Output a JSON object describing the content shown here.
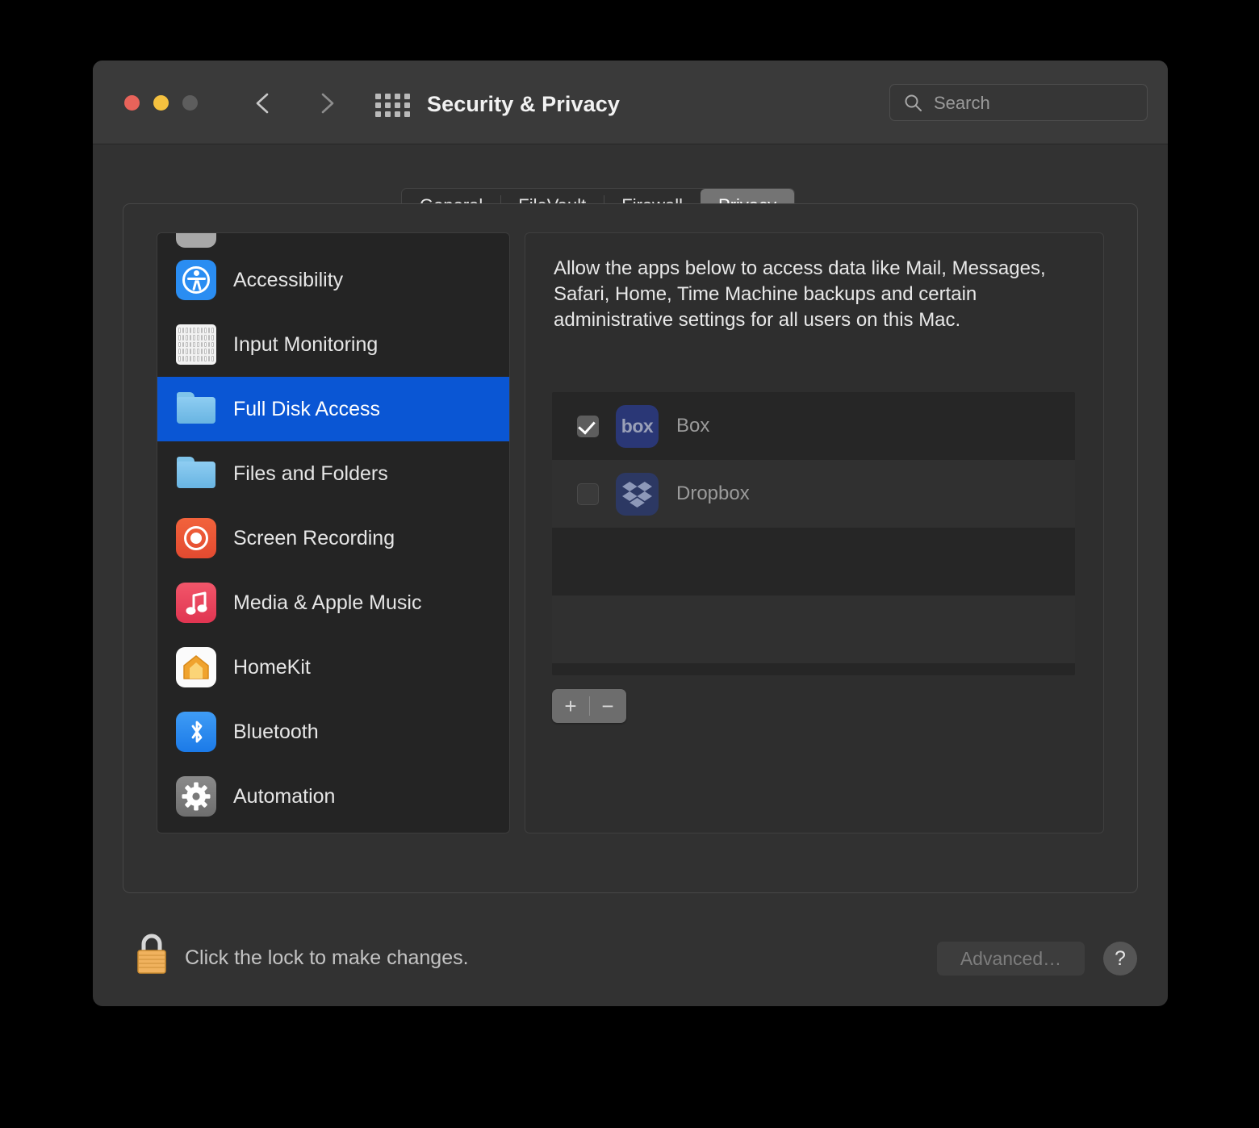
{
  "window": {
    "title": "Security & Privacy",
    "traffic_lights": {
      "close": "close-button",
      "minimize": "minimize-button",
      "zoom": "zoom-button"
    },
    "nav": {
      "back": "back-chevron-icon",
      "forward": "forward-chevron-icon",
      "grid": "show-all-grid-icon"
    },
    "colors": {
      "window_bg": "#323232",
      "titlebar_bg": "#3a3a3a",
      "accent_selection": "#0a56d4",
      "close": "#e8635a",
      "minimize": "#f5c13f",
      "zoom": "#5d5d5d"
    }
  },
  "search": {
    "placeholder": "Search",
    "value": "",
    "icon": "search-icon"
  },
  "tabs": [
    {
      "label": "General",
      "selected": false
    },
    {
      "label": "FileVault",
      "selected": false
    },
    {
      "label": "Firewall",
      "selected": false
    },
    {
      "label": "Privacy",
      "selected": true
    }
  ],
  "sidebar": {
    "items": [
      {
        "label": "Accessibility",
        "icon": "accessibility-icon",
        "selected": false
      },
      {
        "label": "Input Monitoring",
        "icon": "keyboard-icon",
        "selected": false
      },
      {
        "label": "Full Disk Access",
        "icon": "folder-icon",
        "selected": true
      },
      {
        "label": "Files and Folders",
        "icon": "folder-icon",
        "selected": false
      },
      {
        "label": "Screen Recording",
        "icon": "screen-recording-icon",
        "selected": false
      },
      {
        "label": "Media & Apple Music",
        "icon": "music-note-icon",
        "selected": false
      },
      {
        "label": "HomeKit",
        "icon": "home-icon",
        "selected": false
      },
      {
        "label": "Bluetooth",
        "icon": "bluetooth-icon",
        "selected": false
      },
      {
        "label": "Automation",
        "icon": "gear-icon",
        "selected": false
      }
    ]
  },
  "right_panel": {
    "description": "Allow the apps below to access data like Mail, Messages, Safari, Home, Time Machine backups and certain administrative settings for all users on this Mac.",
    "apps": [
      {
        "name": "Box",
        "checked": true,
        "icon": "box-app-icon",
        "icon_text": "box"
      },
      {
        "name": "Dropbox",
        "checked": false,
        "icon": "dropbox-app-icon",
        "icon_text": ""
      }
    ],
    "list_controls": {
      "add_label": "+",
      "remove_label": "−"
    }
  },
  "footer": {
    "lock_icon": "lock-closed-icon",
    "lock_message": "Click the lock to make changes.",
    "advanced_label": "Advanced…",
    "advanced_enabled": false,
    "help_label": "?"
  }
}
